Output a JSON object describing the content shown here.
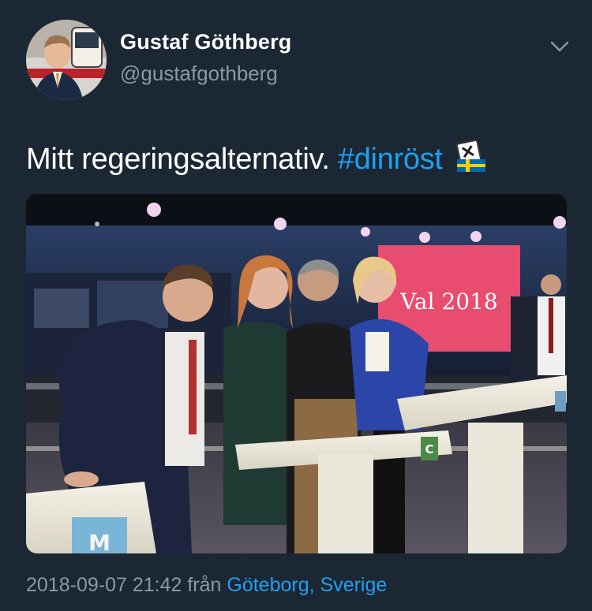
{
  "user": {
    "display_name": "Gustaf Göthberg",
    "handle": "@gustafgothberg"
  },
  "tweet": {
    "text": "Mitt regeringsalternativ.",
    "hashtag": "#dinröst",
    "emoji": "ballot-box-with-sweden-flag"
  },
  "media": {
    "screen_text": "Val 2018",
    "podium_labels": [
      "M",
      "C"
    ]
  },
  "meta": {
    "timestamp": "2018-09-07 21:42",
    "from_label": "från",
    "location": "Göteborg, Sverige"
  },
  "colors": {
    "background": "#1c2734",
    "secondary_text": "#8899a6",
    "link": "#1da1f2",
    "screen_pink": "#e84c6e"
  }
}
